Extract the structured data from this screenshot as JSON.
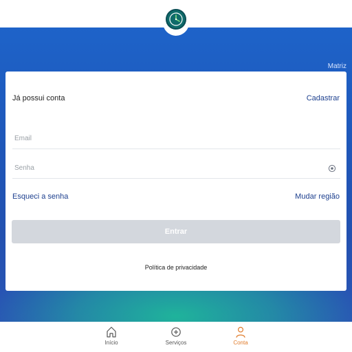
{
  "header": {
    "branch": "Matriz"
  },
  "login": {
    "have_account": "Já possui conta",
    "register_link": "Cadastrar",
    "email_placeholder": "Email",
    "password_placeholder": "Senha",
    "forgot_password": "Esqueci a senha",
    "change_region": "Mudar região",
    "submit_label": "Entrar",
    "privacy_policy": "Política de privacidade"
  },
  "bottom_nav": {
    "items": [
      {
        "label": "Início",
        "icon": "home-icon"
      },
      {
        "label": "Serviços",
        "icon": "plus-circle-icon"
      },
      {
        "label": "Conta",
        "icon": "user-icon",
        "active": true
      }
    ],
    "active_color": "#e07b2a"
  },
  "colors": {
    "gradient_top": "#1e63c9",
    "gradient_glow": "#1fb39b",
    "link": "#1c3f8e",
    "button_disabled": "#d3d7dd"
  }
}
